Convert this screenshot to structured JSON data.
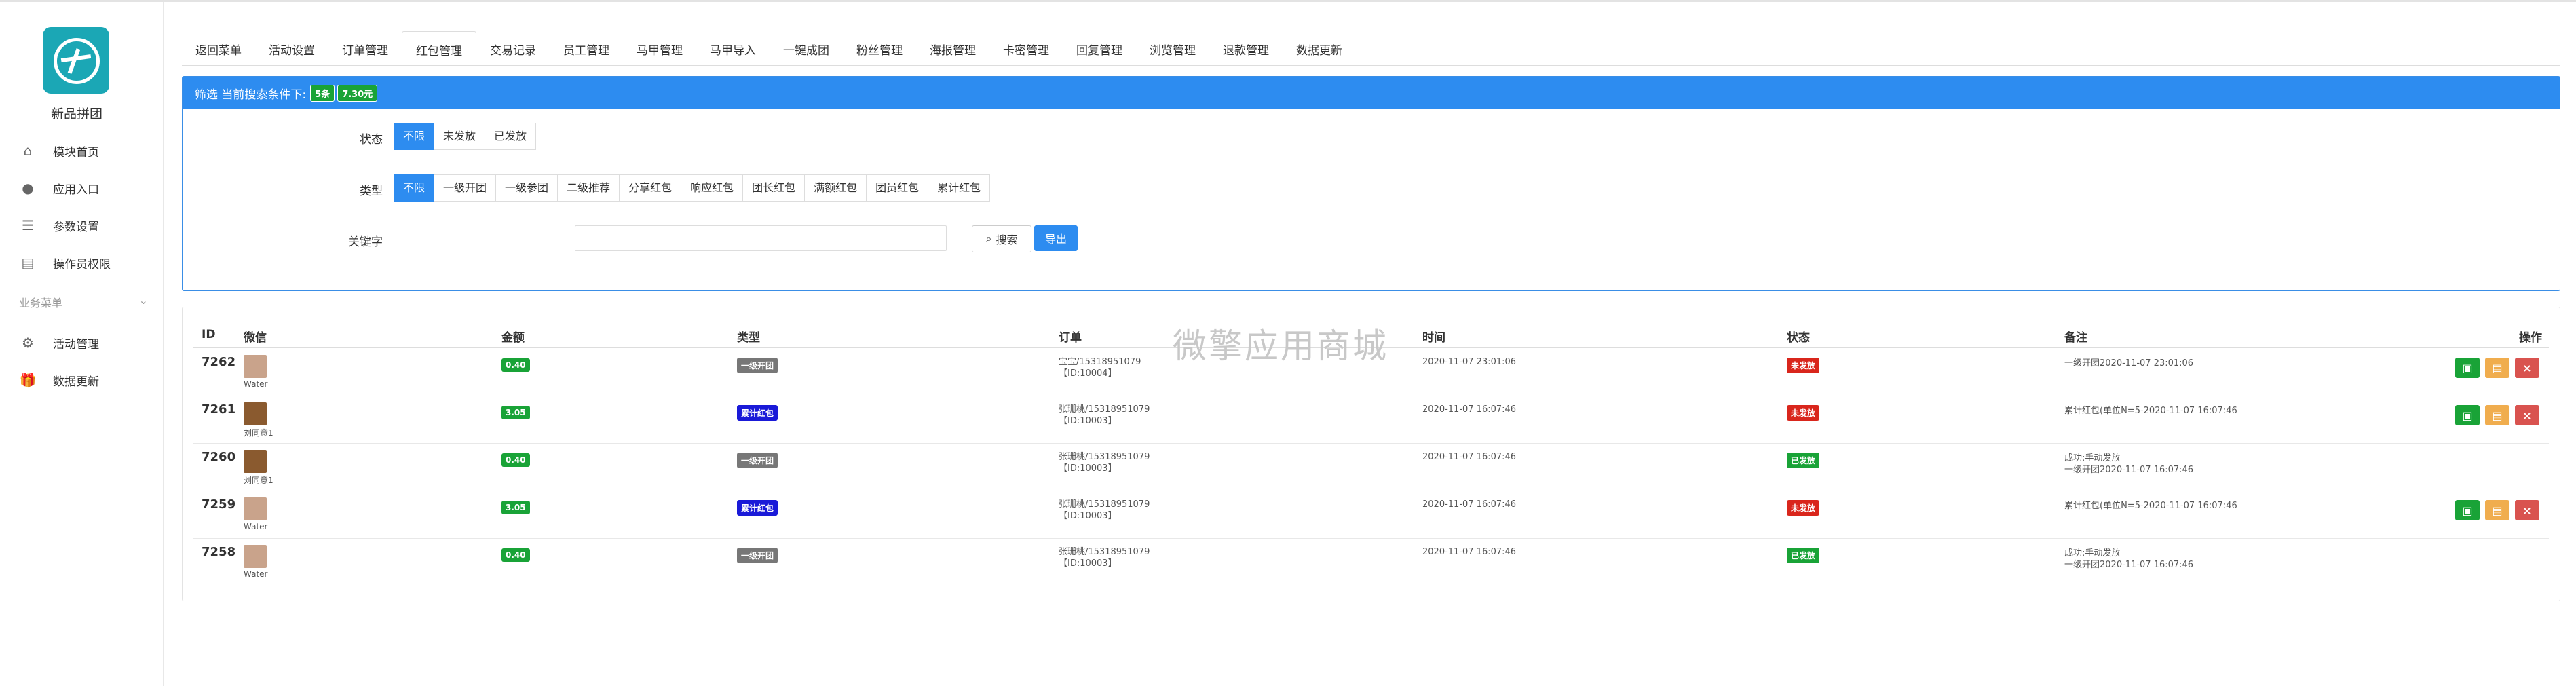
{
  "sidebar": {
    "store_name": "新品拼团",
    "items": [
      {
        "label": "模块首页",
        "icon": "home-icon"
      },
      {
        "label": "应用入口",
        "icon": "chat-icon"
      },
      {
        "label": "参数设置",
        "icon": "list-icon"
      },
      {
        "label": "操作员权限",
        "icon": "document-icon"
      }
    ],
    "section_title": "业务菜单",
    "biz_items": [
      {
        "label": "活动管理",
        "icon": "gear-icon"
      },
      {
        "label": "数据更新",
        "icon": "gift-icon"
      }
    ]
  },
  "tabs": [
    "返回菜单",
    "活动设置",
    "订单管理",
    "红包管理",
    "交易记录",
    "员工管理",
    "马甲管理",
    "马甲导入",
    "一键成团",
    "粉丝管理",
    "海报管理",
    "卡密管理",
    "回复管理",
    "浏览管理",
    "退款管理",
    "数据更新"
  ],
  "active_tab": "红包管理",
  "filter": {
    "header_text": "筛选 当前搜索条件下:",
    "count_badge": "5条",
    "amount_badge": "7.30元",
    "status_label": "状态",
    "status_options": [
      "不限",
      "未发放",
      "已发放"
    ],
    "type_label": "类型",
    "type_options": [
      "不限",
      "一级开团",
      "一级参团",
      "二级推荐",
      "分享红包",
      "响应红包",
      "团长红包",
      "满额红包",
      "团员红包",
      "累计红包"
    ],
    "keyword_label": "关键字",
    "keyword_value": "",
    "search_label": "搜索",
    "export_label": "导出"
  },
  "table": {
    "headers": {
      "id": "ID",
      "wechat": "微信",
      "amount": "金额",
      "type": "类型",
      "order": "订单",
      "time": "时间",
      "status": "状态",
      "remark": "备注",
      "ops": "操作"
    },
    "rows": [
      {
        "id": "7262",
        "name": "Water",
        "amount": "0.40",
        "type": "一级开团",
        "type_color": "gray",
        "order_line1": "宝宝/15318951079",
        "order_line2": "【ID:10004】",
        "time": "2020-11-07 23:01:06",
        "status": "未发放",
        "status_color": "red",
        "remark_line1": "",
        "remark_line2": "一级开团2020-11-07 23:01:06",
        "has_ops": true
      },
      {
        "id": "7261",
        "name": "刘同意1",
        "amount": "3.05",
        "type": "累计红包",
        "type_color": "blue",
        "order_line1": "张珊桃/15318951079",
        "order_line2": "【ID:10003】",
        "time": "2020-11-07 16:07:46",
        "status": "未发放",
        "status_color": "red",
        "remark_line1": "",
        "remark_line2": "累计红包(单位N=5-2020-11-07 16:07:46",
        "has_ops": true
      },
      {
        "id": "7260",
        "name": "刘同意1",
        "amount": "0.40",
        "type": "一级开团",
        "type_color": "gray",
        "order_line1": "张珊桃/15318951079",
        "order_line2": "【ID:10003】",
        "time": "2020-11-07 16:07:46",
        "status": "已发放",
        "status_color": "green",
        "remark_line1": "成功:手动发放",
        "remark_line2": "一级开团2020-11-07 16:07:46",
        "has_ops": false
      },
      {
        "id": "7259",
        "name": "Water",
        "amount": "3.05",
        "type": "累计红包",
        "type_color": "blue",
        "order_line1": "张珊桃/15318951079",
        "order_line2": "【ID:10003】",
        "time": "2020-11-07 16:07:46",
        "status": "未发放",
        "status_color": "red",
        "remark_line1": "",
        "remark_line2": "累计红包(单位N=5-2020-11-07 16:07:46",
        "has_ops": true
      },
      {
        "id": "7258",
        "name": "Water",
        "amount": "0.40",
        "type": "一级开团",
        "type_color": "gray",
        "order_line1": "张珊桃/15318951079",
        "order_line2": "【ID:10003】",
        "time": "2020-11-07 16:07:46",
        "status": "已发放",
        "status_color": "green",
        "remark_line1": "成功:手动发放",
        "remark_line2": "一级开团2020-11-07 16:07:46",
        "has_ops": false
      }
    ]
  },
  "watermark": "微擎应用商城"
}
